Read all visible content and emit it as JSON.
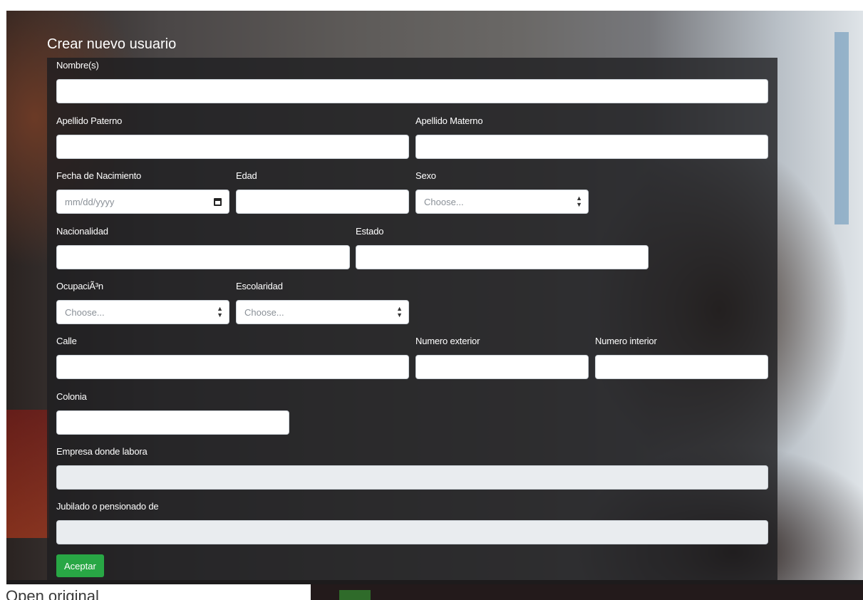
{
  "form": {
    "title": "Crear nuevo usuario",
    "fields": {
      "nombres": {
        "label": "Nombre(s)",
        "value": ""
      },
      "apellido_paterno": {
        "label": "Apellido Paterno",
        "value": ""
      },
      "apellido_materno": {
        "label": "Apellido Materno",
        "value": ""
      },
      "fecha_nacimiento": {
        "label": "Fecha de Nacimiento",
        "placeholder": "mm/dd/yyyy"
      },
      "edad": {
        "label": "Edad",
        "value": ""
      },
      "sexo": {
        "label": "Sexo",
        "selected": "Choose..."
      },
      "nacionalidad": {
        "label": "Nacionalidad",
        "value": ""
      },
      "estado": {
        "label": "Estado",
        "value": ""
      },
      "ocupacion": {
        "label": "OcupaciÃ³n",
        "selected": "Choose..."
      },
      "escolaridad": {
        "label": "Escolaridad",
        "selected": "Choose..."
      },
      "calle": {
        "label": "Calle",
        "value": ""
      },
      "numero_exterior": {
        "label": "Numero exterior",
        "value": ""
      },
      "numero_interior": {
        "label": "Numero interior",
        "value": ""
      },
      "colonia": {
        "label": "Colonia",
        "value": ""
      },
      "empresa": {
        "label": "Empresa donde labora",
        "value": ""
      },
      "jubilado": {
        "label": "Jubilado o pensionado de",
        "value": ""
      }
    },
    "submit_label": "Aceptar"
  },
  "footer": {
    "link_text": "Open original"
  },
  "icons": {
    "calendar": "calendar-icon",
    "select_caret": "updown-caret-icon"
  },
  "colors": {
    "submit": "#28a745",
    "panel": "#1e1e20"
  }
}
